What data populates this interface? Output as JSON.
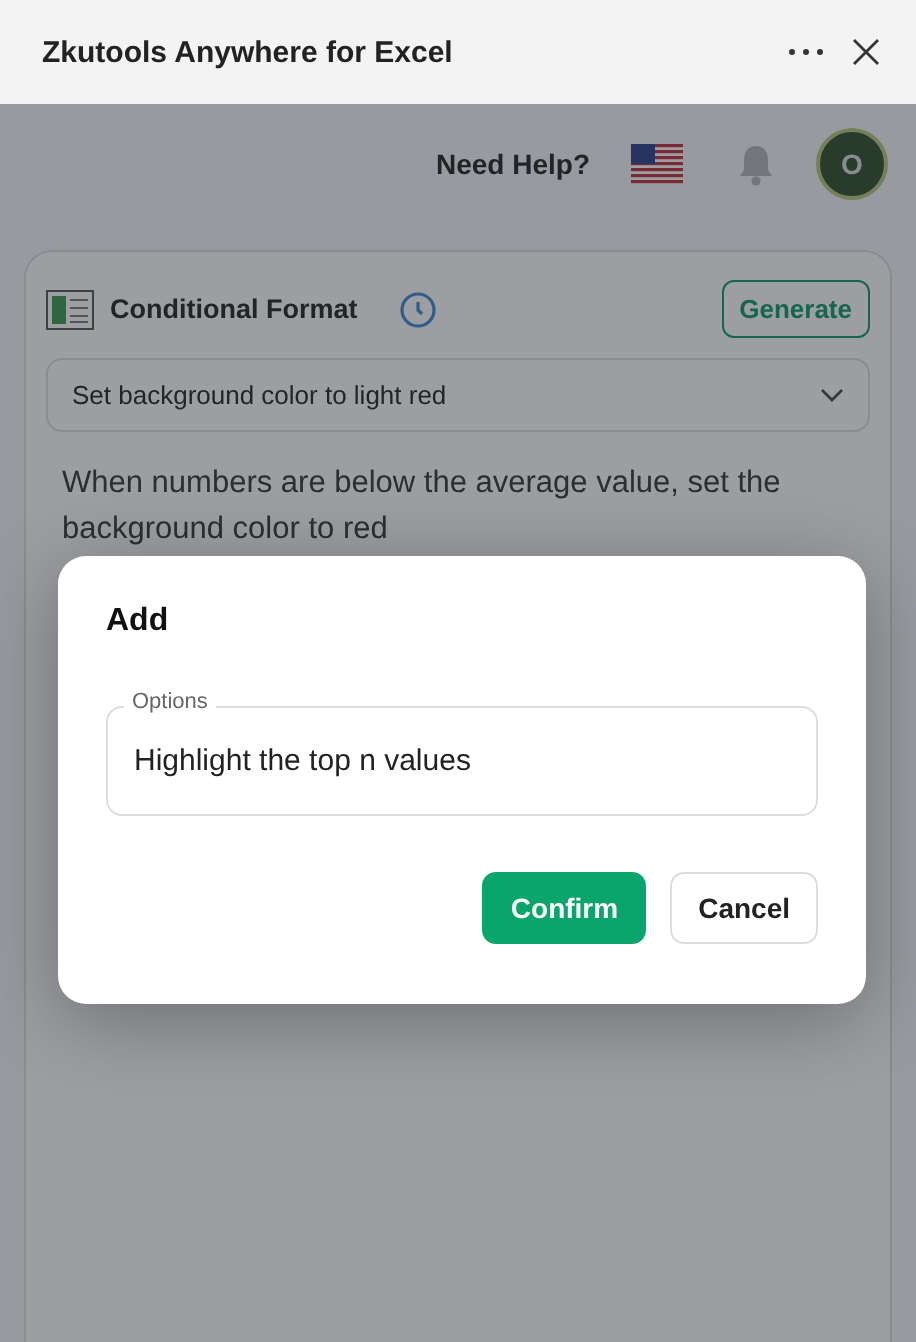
{
  "window": {
    "title": "Zkutools Anywhere for Excel"
  },
  "header": {
    "help_link": "Need Help?",
    "avatar": "O"
  },
  "tool_card": {
    "title": "Conditional Format",
    "generate_button": "Generate",
    "dropdown": {
      "value": "Set background color to light red"
    },
    "description": "When numbers are below the average value, set the background color to red"
  },
  "dialog": {
    "title": "Add",
    "field": {
      "label": "Options",
      "value": "Highlight the top n values"
    },
    "buttons": [
      {
        "label": "Confirm",
        "kind": "primary"
      },
      {
        "label": "Cancel",
        "kind": "secondary"
      }
    ]
  }
}
